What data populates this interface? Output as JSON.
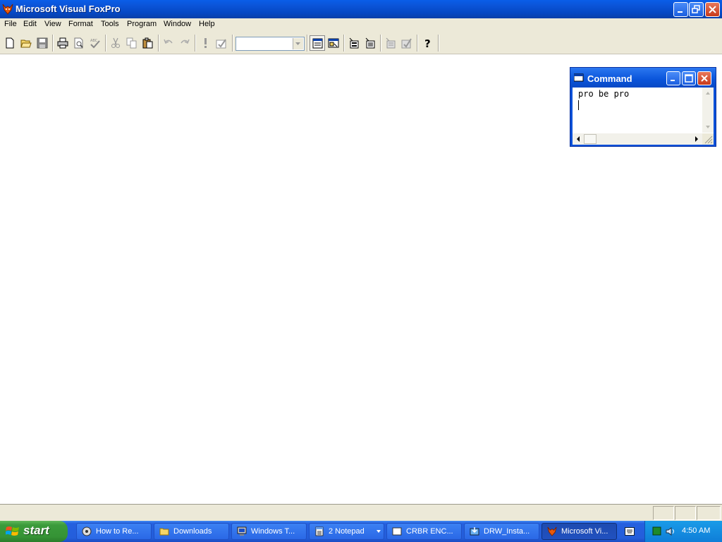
{
  "window": {
    "title": "Microsoft Visual FoxPro",
    "icon": "foxpro-fox-icon"
  },
  "menu": {
    "items": [
      "File",
      "Edit",
      "View",
      "Format",
      "Tools",
      "Program",
      "Window",
      "Help"
    ]
  },
  "toolbar": {
    "buttons": [
      "new-icon",
      "open-icon",
      "save-icon",
      "print-icon",
      "print-preview-icon",
      "spell-check-icon",
      "cut-icon",
      "copy-icon",
      "paste-icon",
      "undo-icon",
      "redo-icon",
      "run-icon",
      "modify-form-icon",
      "command-window-icon",
      "data-session-icon",
      "form-designer-icon",
      "report-designer-icon",
      "expression-builder-icon",
      "form-wizard-icon",
      "help-icon"
    ],
    "combo_value": ""
  },
  "command_window": {
    "title": "Command",
    "text": "pro be pro"
  },
  "taskbar": {
    "start_label": "start",
    "tasks": [
      {
        "label": "How to Re...",
        "icon": "recovery-icon"
      },
      {
        "label": "Downloads",
        "icon": "folder-icon"
      },
      {
        "label": "Windows T...",
        "icon": "computer-icon"
      },
      {
        "label": "2 Notepad",
        "icon": "notepad-icon"
      },
      {
        "label": "CRBR ENC...",
        "icon": "window-icon"
      },
      {
        "label": "DRW_Insta...",
        "icon": "installer-icon"
      },
      {
        "label": "Microsoft Vi...",
        "icon": "foxpro-fox-icon"
      }
    ],
    "clock": "4:50 AM"
  },
  "colors": {
    "titlebar_blue": "#0548c4",
    "chrome_beige": "#ece9d8",
    "start_green": "#3b9b3b",
    "taskbar_blue": "#245edb"
  }
}
